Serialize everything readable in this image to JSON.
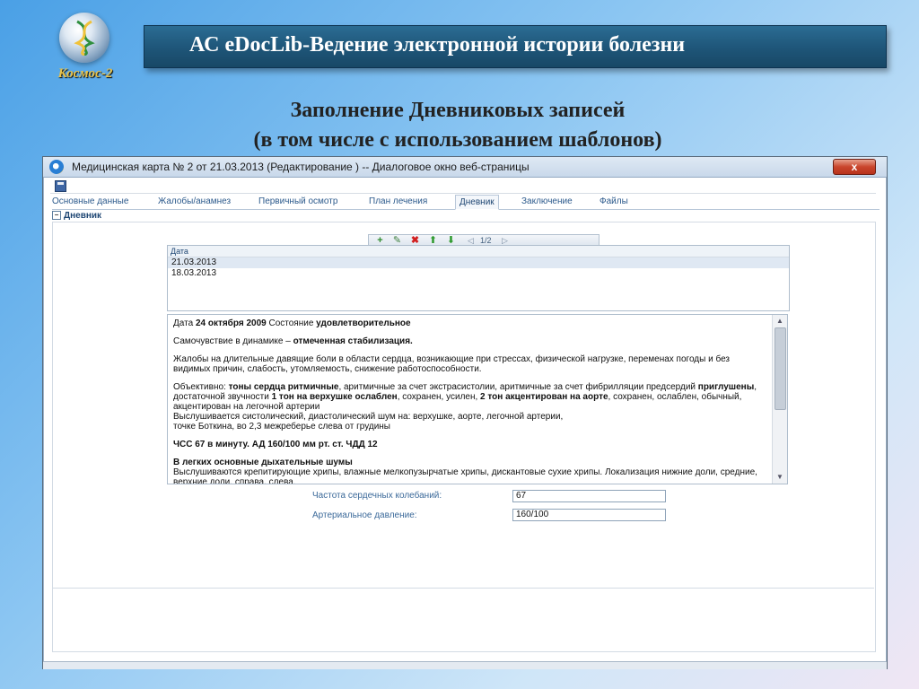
{
  "logo": {
    "text": "Космос-2"
  },
  "banner": {
    "title": "АС  eDocLib-Ведение электронной истории болезни"
  },
  "slide": {
    "subtitle_line1": "Заполнение Дневниковых записей",
    "subtitle_line2": "(в том числе с использованием шаблонов)"
  },
  "window": {
    "title": "Медицинская карта № 2 от 21.03.2013 (Редактирование ) -- Диалоговое окно веб-страницы",
    "close_label": "x"
  },
  "tabs": [
    {
      "label": "Основные данные"
    },
    {
      "label": "Жалобы/анамнез"
    },
    {
      "label": "Первичный осмотр"
    },
    {
      "label": "План лечения"
    },
    {
      "label": "Дневник"
    },
    {
      "label": "Заключение"
    },
    {
      "label": "Файлы"
    }
  ],
  "active_tab": "Дневник",
  "section": {
    "label": "Дневник"
  },
  "grid_toolbar": {
    "pager": "1/2"
  },
  "date_grid": {
    "header": "Дата",
    "rows": [
      "21.03.2013",
      "18.03.2013"
    ]
  },
  "editor": {
    "line1_label": "Дата",
    "line1_date": "24 октября 2009",
    "line1_state_label": "Состояние",
    "line1_state": "удовлетворительное",
    "p2_label": "Самочувствие в динамике –",
    "p2_value": "отмеченная стабилизация.",
    "p3": "Жалобы на длительные давящие боли в области сердца, возникающие  при стрессах, физической нагрузке, переменах погоды и без видимых причин, слабость, утомляемость, снижение работоспособности.",
    "p4_a": "Объективно:",
    "p4_b": "тоны сердца ритмичные",
    "p4_c": ", аритмичные за счет  экстрасистолии,  аритмичные за счет  фибрилляции предсердий",
    "p4_d": "приглушены",
    "p4_e": ",  достаточной звучности",
    "p4_f": "1 тон на верхушке ослаблен",
    "p4_g": ", сохранен, усилен,",
    "p4_h": "2 тон акцентирован на аорте",
    "p4_i": ", сохранен, ослаблен, обычный, акцентирован на легочной артерии",
    "p4_j": "Выслушивается систолический, диастолический шум на: верхушке, аорте, легочной артерии,",
    "p4_k": "точке Боткина, во 2,3 межреберье слева от грудины",
    "p5": "ЧСС   67 в минуту.  АД 160/100 мм рт. ст.  ЧДД 12",
    "p6_bold": "В легких основные дыхательные шумы",
    "p6_text": "Выслушиваются крепитирующие хрипы, влажные мелкопузырчатые хрипы, дискантовые сухие хрипы. Локализация нижние доли, средние, верхние  доли, справа, слева."
  },
  "fields": {
    "heart_rate_label": "Частота сердечных колебаний:",
    "heart_rate_value": "67",
    "bp_label": "Артериальное давление:",
    "bp_value": "160/100"
  }
}
